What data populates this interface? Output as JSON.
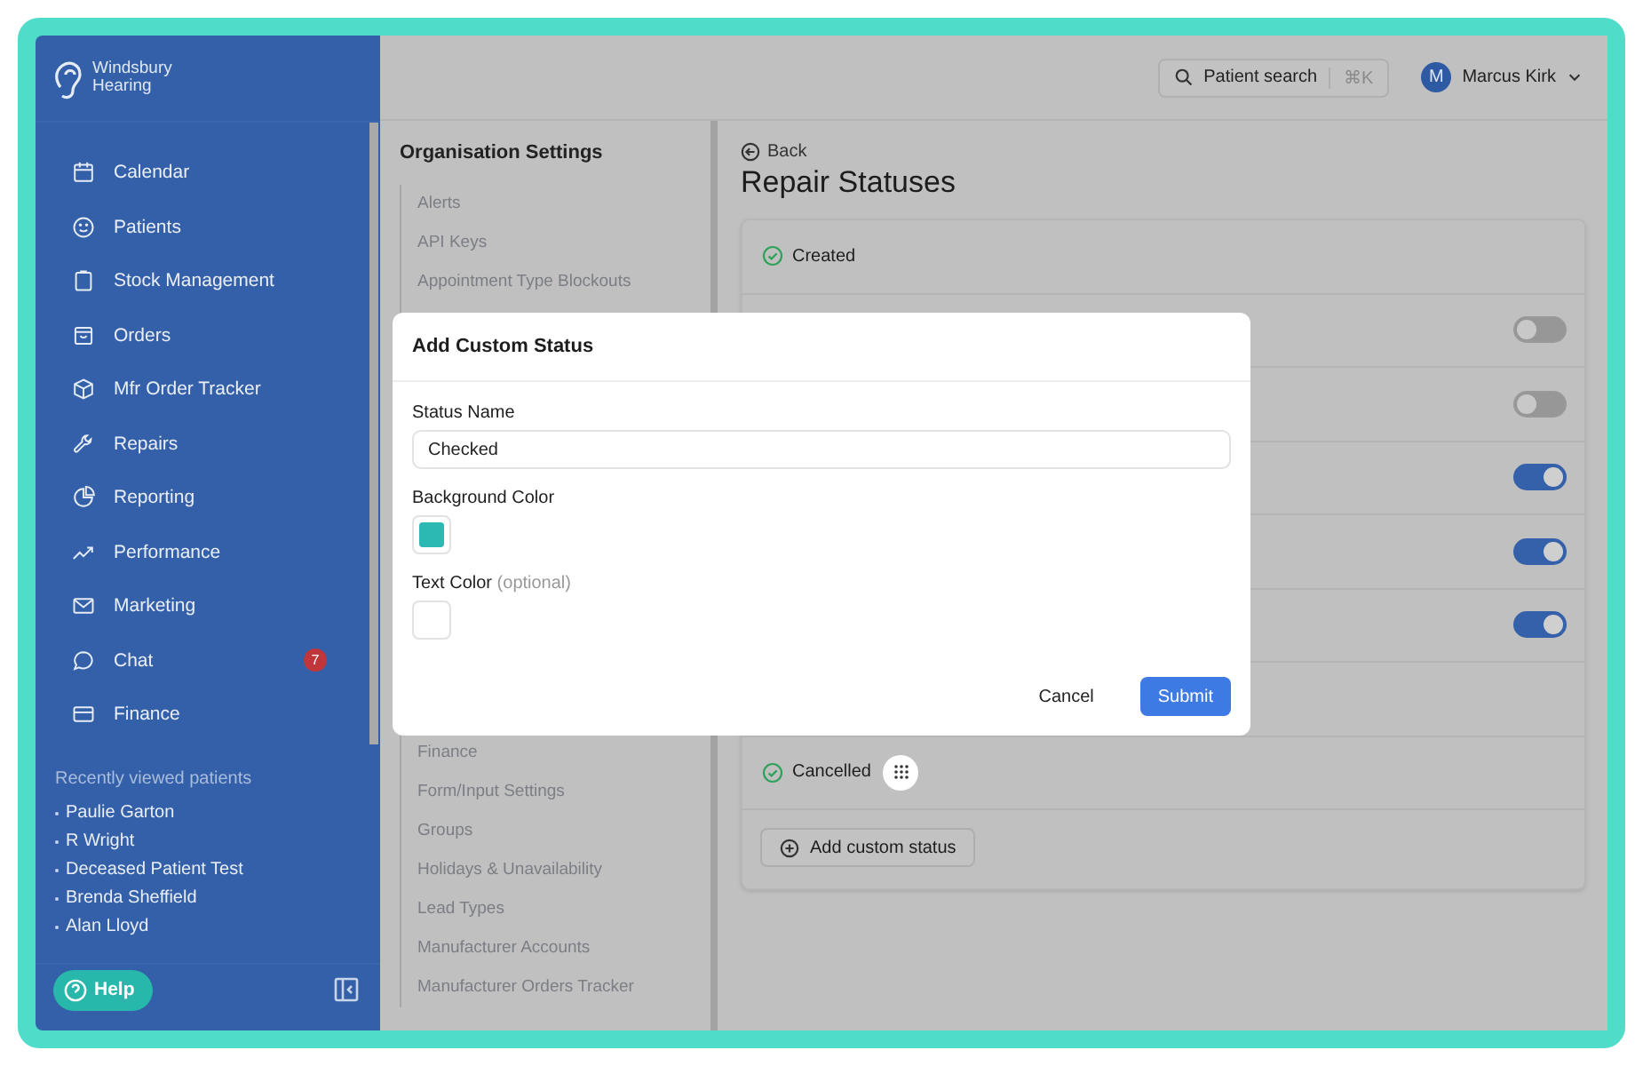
{
  "sidebar": {
    "logo": [
      "Windsbury",
      "Hearing"
    ],
    "items": [
      {
        "label": "Calendar"
      },
      {
        "label": "Patients"
      },
      {
        "label": "Stock Management"
      },
      {
        "label": "Orders"
      },
      {
        "label": "Mfr Order Tracker"
      },
      {
        "label": "Repairs"
      },
      {
        "label": "Reporting"
      },
      {
        "label": "Performance"
      },
      {
        "label": "Marketing"
      },
      {
        "label": "Chat",
        "badge": "7"
      },
      {
        "label": "Finance"
      }
    ],
    "recent_title": "Recently viewed patients",
    "recent": [
      "Paulie Garton",
      "R Wright",
      "Deceased Patient Test",
      "Brenda Sheffield",
      "Alan Lloyd"
    ],
    "help": "Help"
  },
  "topbar": {
    "search": "Patient search",
    "shortcut": "⌘K",
    "avatar": "M",
    "user": "Marcus Kirk"
  },
  "settings_nav": {
    "title": "Organisation Settings",
    "items": [
      "Alerts",
      "API Keys",
      "Appointment Type Blockouts",
      "Finance",
      "Form/Input Settings",
      "Groups",
      "Holidays & Unavailability",
      "Lead Types",
      "Manufacturer Accounts",
      "Manufacturer Orders Tracker"
    ]
  },
  "page": {
    "back": "Back",
    "title": "Repair Statuses",
    "statuses": [
      {
        "kind": "fixed",
        "label": "Created"
      },
      {
        "kind": "toggle",
        "on": false
      },
      {
        "kind": "toggle",
        "on": false
      },
      {
        "kind": "toggle",
        "on": true
      },
      {
        "kind": "toggle",
        "on": true
      },
      {
        "kind": "toggle",
        "on": true
      },
      {
        "kind": "fixed"
      },
      {
        "kind": "fixed",
        "label": "Cancelled"
      }
    ],
    "add_button": "Add custom status"
  },
  "modal": {
    "title": "Add Custom Status",
    "fields": [
      {
        "kind": "text",
        "label": "Status Name",
        "value": "Checked"
      },
      {
        "kind": "color",
        "label": "Background Color",
        "color": "#2cb8b3"
      },
      {
        "kind": "color",
        "label": "Text Color",
        "hint": "(optional)",
        "color": "#ffffff"
      }
    ],
    "cancel": "Cancel",
    "submit": "Submit"
  }
}
